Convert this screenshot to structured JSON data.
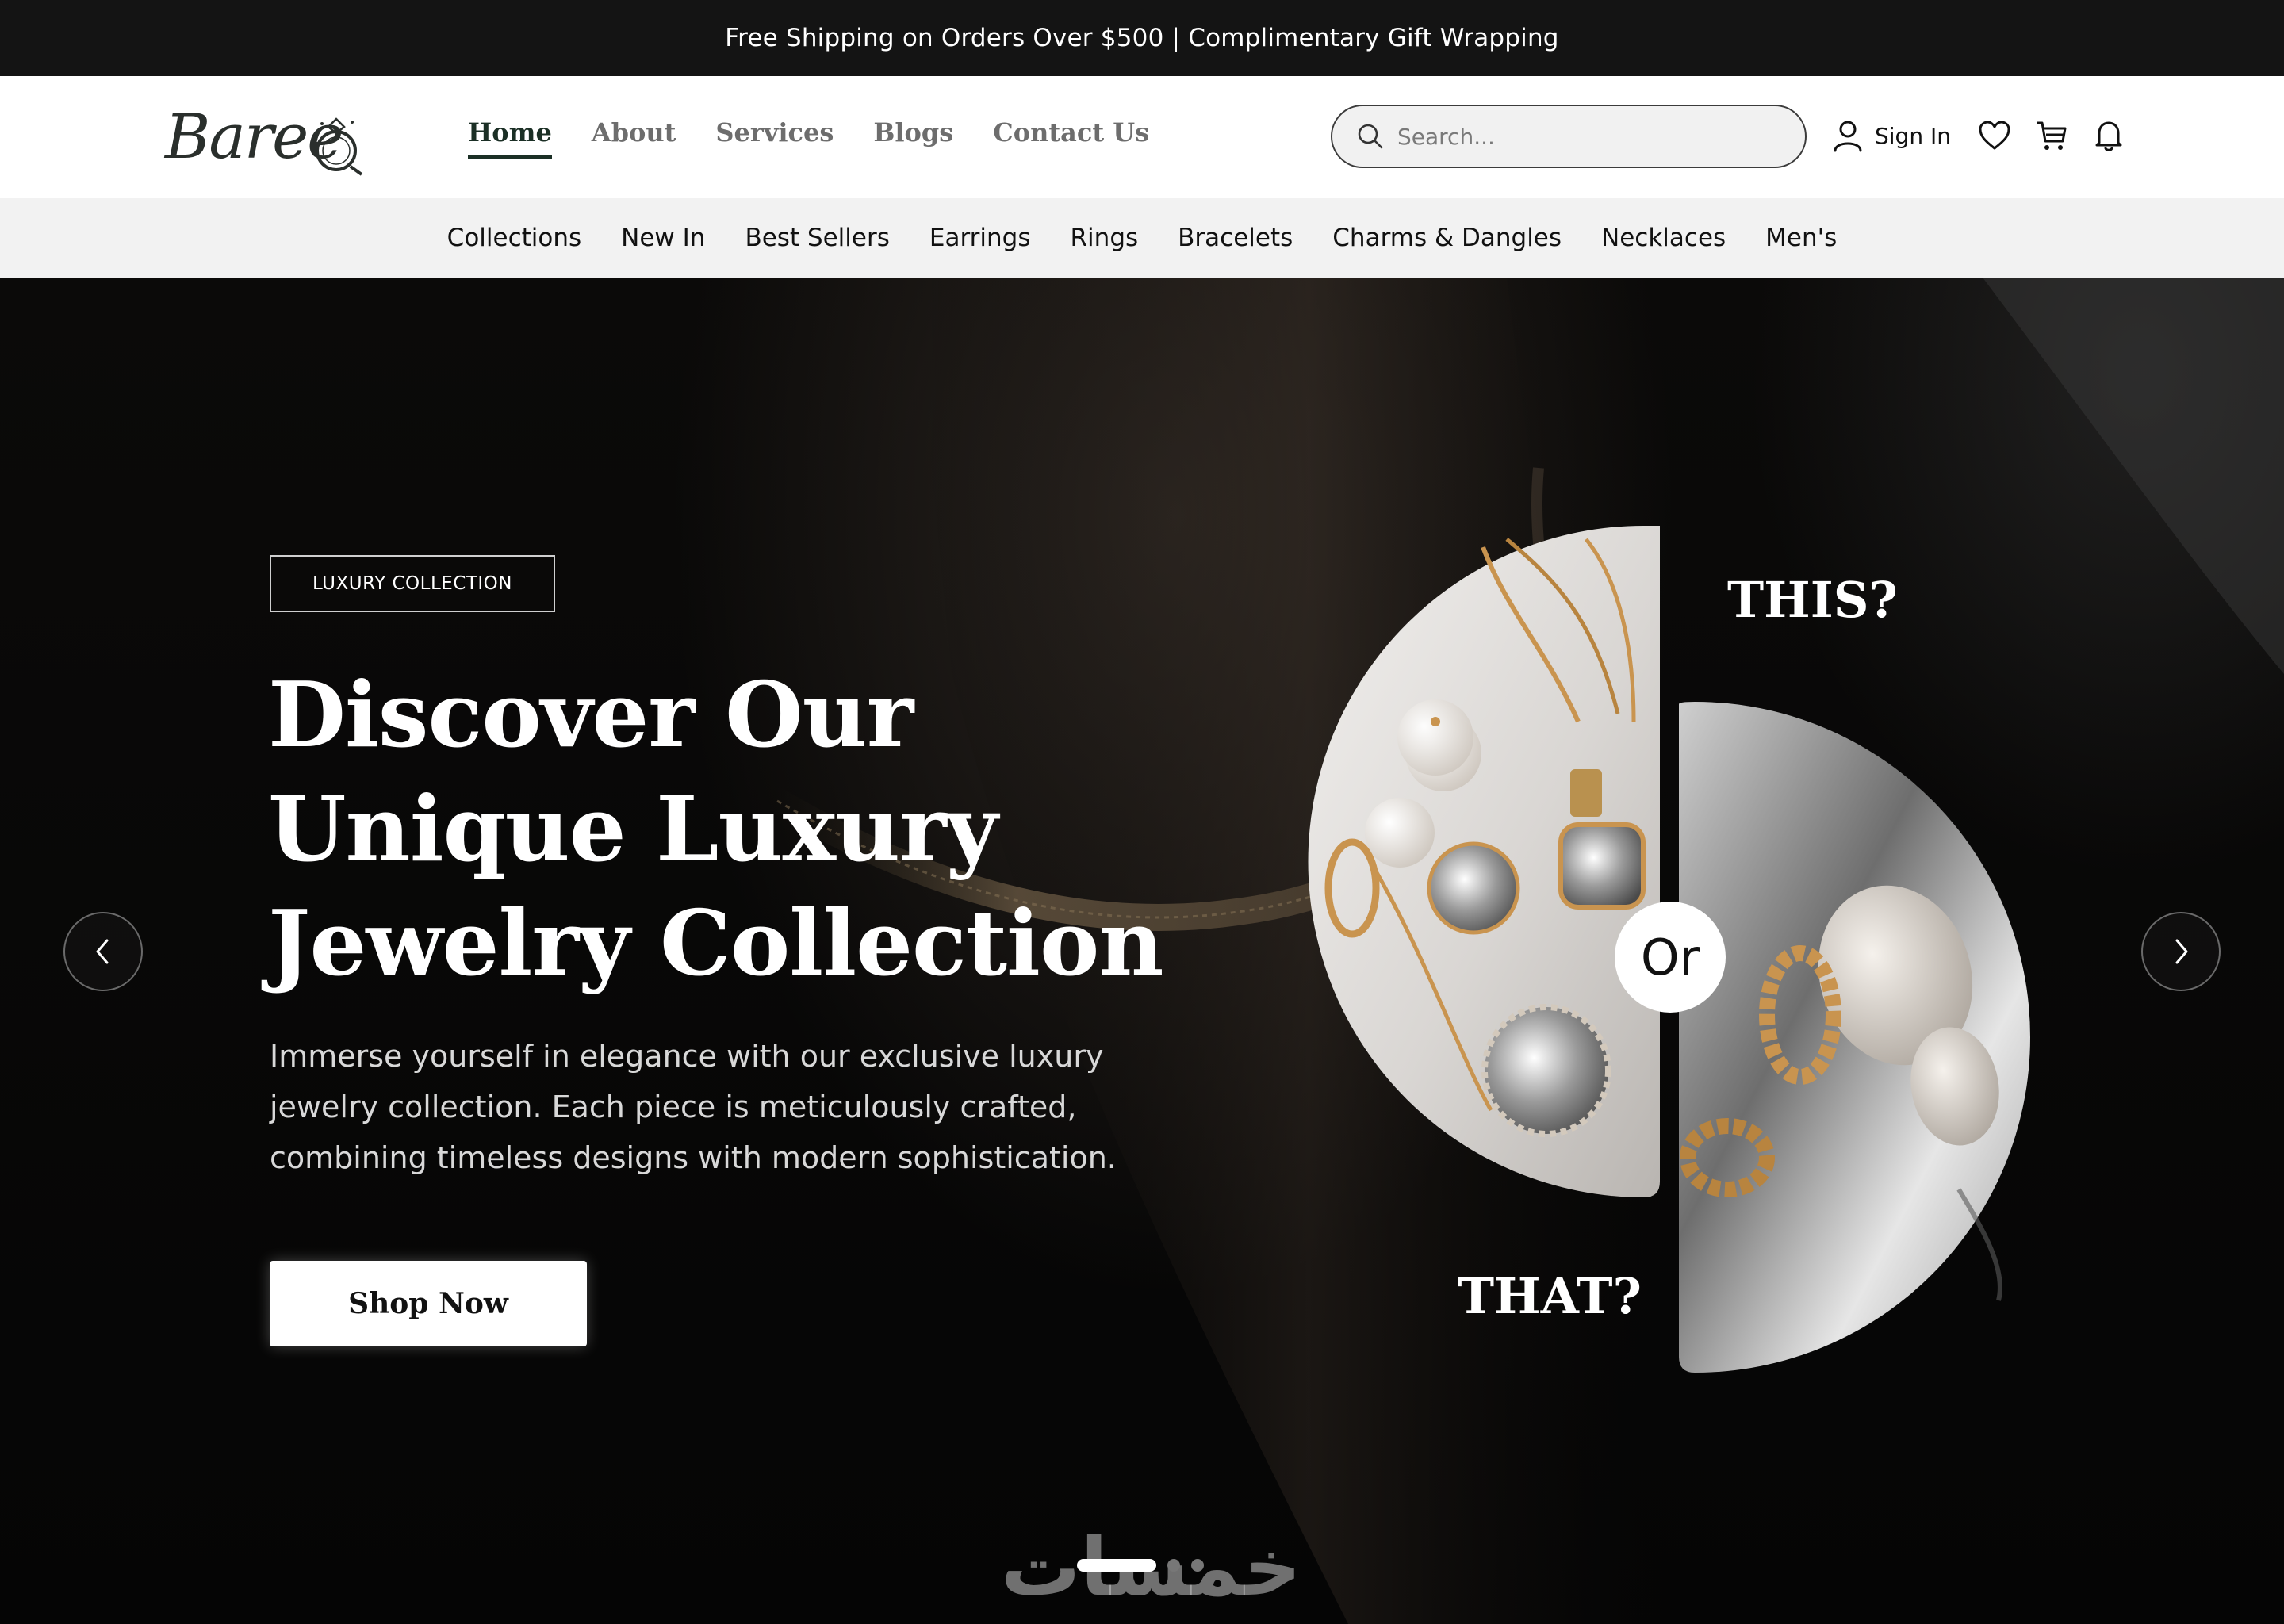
{
  "announcement": {
    "text": "Free Shipping on Orders Over $500 | Complimentary Gift Wrapping"
  },
  "brand": {
    "logo_text": "Baree",
    "logo_icon": "ring-icon"
  },
  "main_nav": {
    "items": [
      {
        "label": "Home",
        "active": true
      },
      {
        "label": "About",
        "active": false
      },
      {
        "label": "Services",
        "active": false
      },
      {
        "label": "Blogs",
        "active": false
      },
      {
        "label": "Contact Us",
        "active": false
      }
    ]
  },
  "search": {
    "placeholder": "Search..."
  },
  "account": {
    "sign_in_label": "Sign In",
    "icons": [
      "user-icon",
      "heart-icon",
      "cart-icon",
      "bell-icon"
    ]
  },
  "category_nav": {
    "items": [
      "Collections",
      "New In",
      "Best Sellers",
      "Earrings",
      "Rings",
      "Bracelets",
      "Charms & Dangles",
      "Necklaces",
      "Men's"
    ]
  },
  "hero": {
    "badge": "LUXURY COLLECTION",
    "headline_lines": [
      "Discover Our",
      "Unique Luxury",
      "Jewelry Collection"
    ],
    "subtext": "Immerse yourself in elegance with our exclusive luxury jewelry collection. Each piece is meticulously crafted, combining timeless designs with modern sophistication.",
    "cta_label": "Shop Now",
    "compare": {
      "top_label": "THIS?",
      "middle_label": "Or",
      "bottom_label": "THAT?"
    },
    "slider": {
      "slide_count": 3,
      "active_index": 0
    }
  },
  "watermark": {
    "text": "خمسات"
  },
  "colors": {
    "topbar_bg": "#141414",
    "header_bg": "#ffffff",
    "category_bg": "#f2f2f2",
    "accent_dark_green": "#1b2f25",
    "hero_bg": "#050505",
    "gold": "#c9944f"
  }
}
